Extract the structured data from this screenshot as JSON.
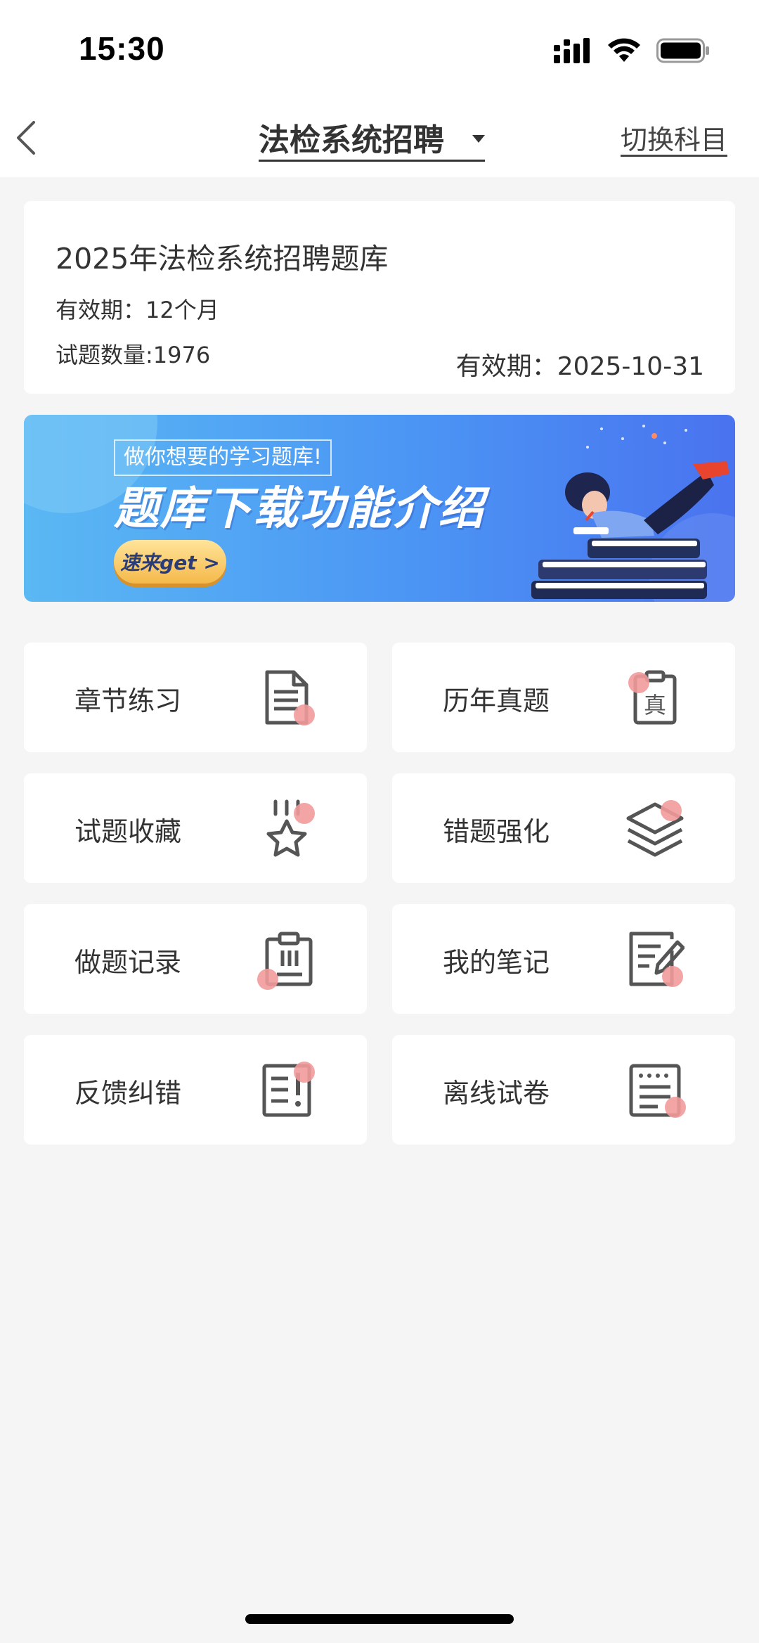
{
  "status_bar": {
    "time": "15:30"
  },
  "nav": {
    "title": "法检系统招聘",
    "switch_label": "切换科目"
  },
  "info": {
    "title": "2025年法检系统招聘题库",
    "validity": "有效期：12个月",
    "count": "试题数量:1976",
    "expire": "有效期：2025-10-31"
  },
  "banner": {
    "subtitle": "做你想要的学习题库!",
    "title": "题库下载功能介绍",
    "button": "速来get >"
  },
  "tiles": [
    {
      "label": "章节练习",
      "icon": "document-icon"
    },
    {
      "label": "历年真题",
      "icon": "exam-paper-icon"
    },
    {
      "label": "试题收藏",
      "icon": "star-icon"
    },
    {
      "label": "错题强化",
      "icon": "layers-icon"
    },
    {
      "label": "做题记录",
      "icon": "clipboard-icon"
    },
    {
      "label": "我的笔记",
      "icon": "note-edit-icon"
    },
    {
      "label": "反馈纠错",
      "icon": "feedback-icon"
    },
    {
      "label": "离线试卷",
      "icon": "offline-paper-icon"
    }
  ]
}
